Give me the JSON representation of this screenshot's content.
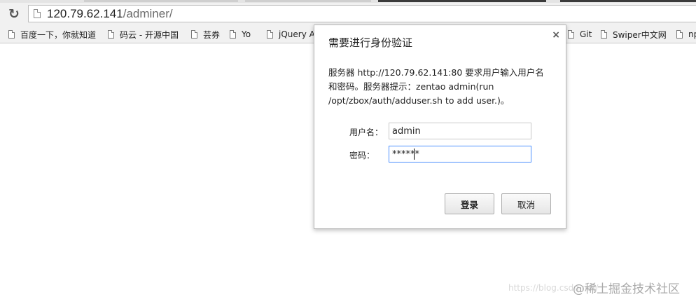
{
  "address_bar": {
    "url_host": "120.79.62.141",
    "url_path": "/adminer/"
  },
  "bookmarks": [
    {
      "label": "百度一下，你就知道"
    },
    {
      "label": "码云 - 开源中国"
    },
    {
      "label": "芸券"
    },
    {
      "label": "Yo"
    },
    {
      "label": "jQuery A"
    },
    {
      "label": "Git"
    },
    {
      "label": "Swiper中文网"
    },
    {
      "label": "np"
    }
  ],
  "dialog": {
    "title": "需要进行身份验证",
    "close_glyph": "×",
    "message": "服务器 http://120.79.62.141:80 要求用户输入用户名和密码。服务器提示：zentao admin(run /opt/zbox/auth/adduser.sh to add user.)。",
    "username_label": "用户名：",
    "username_value": "admin",
    "password_label": "密码：",
    "password_value": "******",
    "login_label": "登录",
    "cancel_label": "取消"
  },
  "watermark": {
    "url_text": "https://blog.csdn.net/",
    "brand_text": "@稀土掘金技术社区"
  }
}
